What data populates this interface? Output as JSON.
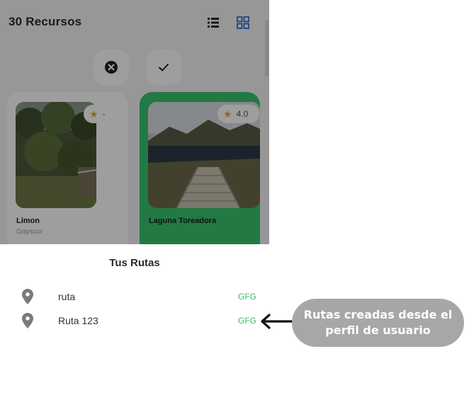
{
  "header": {
    "resource_count": "30",
    "resource_label": "Recursos"
  },
  "cards": [
    {
      "name": "Limon",
      "subtitle": "Gayscur",
      "rating": "-"
    },
    {
      "name": "Laguna Toreadora",
      "subtitle": "",
      "rating": "4.0"
    }
  ],
  "sheet": {
    "title": "Tus Rutas",
    "routes": [
      {
        "name": "ruta",
        "tag": "GFG"
      },
      {
        "name": "Ruta 123",
        "tag": "GFG"
      }
    ]
  },
  "callout": {
    "line1": "Rutas creadas desde el",
    "line2": "perfil de usuario"
  },
  "colors": {
    "accent_green": "#38c36c",
    "tag_green": "#3fbe6b",
    "grid_icon_blue": "#2f6fd6",
    "callout_gray": "#a7a7a7",
    "star": "#f4a51c"
  },
  "icons": [
    "list-view-icon",
    "grid-view-icon",
    "close-circle-icon",
    "check-icon",
    "star-icon",
    "location-pin-icon",
    "arrow-left-icon"
  ]
}
